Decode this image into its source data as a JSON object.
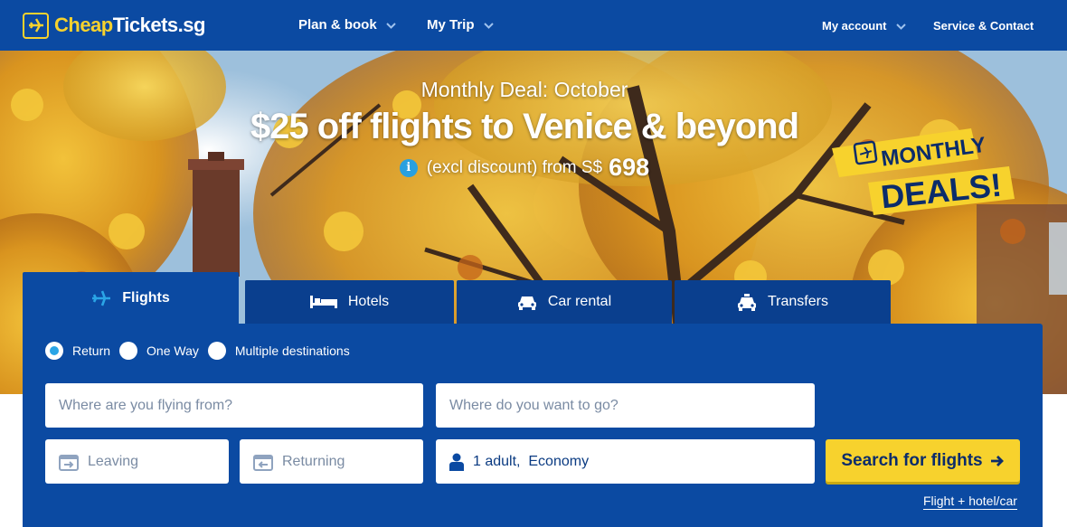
{
  "header": {
    "logo_part1": "Cheap",
    "logo_part2": "Tickets.sg",
    "nav": {
      "plan_book": "Plan & book",
      "my_trip": "My Trip",
      "my_account": "My account",
      "service_contact": "Service & Contact"
    }
  },
  "hero": {
    "deal_subtitle": "Monthly Deal: October",
    "deal_title": "$25 off flights to Venice & beyond",
    "price_prefix": "(excl discount) from S$",
    "price_amount": "698",
    "badge_line1": "MONTHLY",
    "badge_line2": "DEALS!"
  },
  "tabs": [
    {
      "label": "Flights",
      "icon": "plane-icon",
      "active": true
    },
    {
      "label": "Hotels",
      "icon": "bed-icon",
      "active": false
    },
    {
      "label": "Car rental",
      "icon": "car-icon",
      "active": false
    },
    {
      "label": "Transfers",
      "icon": "taxi-icon",
      "active": false
    }
  ],
  "search": {
    "trip_types": [
      "Return",
      "One Way",
      "Multiple destinations"
    ],
    "selected_trip_type": "Return",
    "from_placeholder": "Where are you flying from?",
    "to_placeholder": "Where do you want to go?",
    "leaving_placeholder": "Leaving",
    "returning_placeholder": "Returning",
    "passengers_value": "1 adult,  Economy",
    "search_button": "Search for flights",
    "combo_link": "Flight + hotel/car"
  },
  "colors": {
    "primary_blue": "#0b4aa2",
    "accent_yellow": "#f7d22d",
    "radio_selected": "#2aa5e6"
  }
}
